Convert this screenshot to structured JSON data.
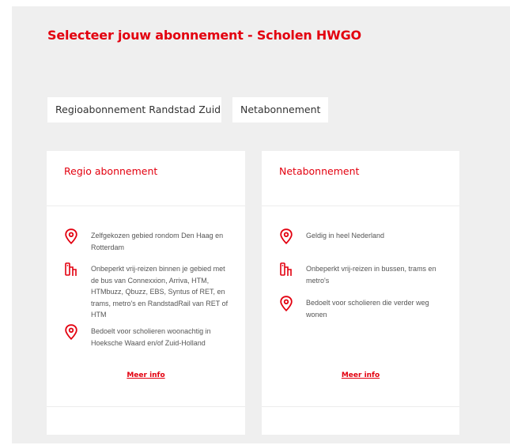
{
  "page": {
    "title": "Selecteer jouw abonnement - Scholen HWGO"
  },
  "tabs": [
    {
      "label": "Regioabonnement Randstad Zuid"
    },
    {
      "label": "Netabonnement"
    }
  ],
  "cards": [
    {
      "title": "Regio abonnement",
      "features": [
        {
          "icon": "location-pin-icon",
          "text": "Zelfgekozen gebied rondom Den Haag en Rotterdam"
        },
        {
          "icon": "transit-route-icon",
          "text": "Onbeperkt vrij-reizen binnen je gebied met de bus van Connexxion, Arriva, HTM, HTMbuzz, Qbuzz, EBS, Syntus of RET, en trams, metro's en RandstadRail van RET of HTM"
        },
        {
          "icon": "location-pin-icon",
          "text": "Bedoelt voor scholieren woonachtig in Hoeksche Waard en/of Zuid-Holland"
        }
      ],
      "link": "Meer info"
    },
    {
      "title": "Netabonnement",
      "features": [
        {
          "icon": "location-pin-icon",
          "text": "Geldig in heel Nederland"
        },
        {
          "icon": "transit-route-icon",
          "text": "Onbeperkt vrij-reizen in bussen, trams en metro's"
        },
        {
          "icon": "location-pin-icon",
          "text": "Bedoelt voor scholieren die verder weg wonen"
        }
      ],
      "link": "Meer info"
    }
  ],
  "colors": {
    "accent": "#e3000f",
    "background": "#efefef",
    "card": "#ffffff",
    "text": "#555555"
  }
}
